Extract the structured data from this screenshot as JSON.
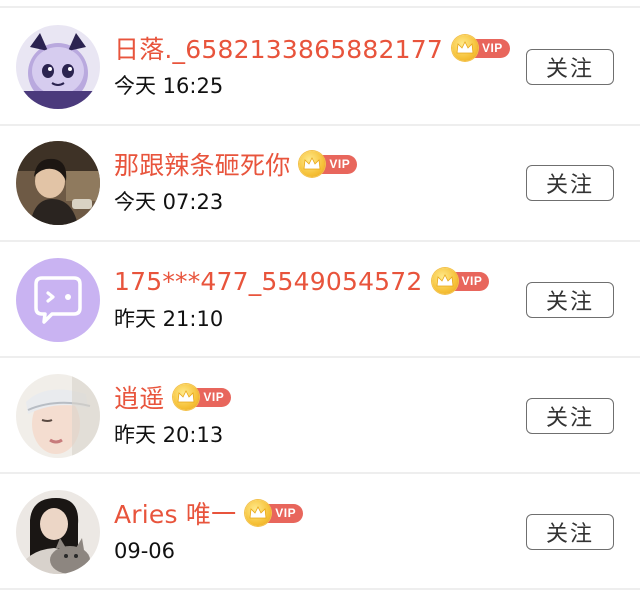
{
  "followers": [
    {
      "name": "日落._6582133865882177",
      "vip": "VIP",
      "time": "今天 16:25",
      "button": "关注",
      "avatar_icon": "cat-cartoon-avatar"
    },
    {
      "name": "那跟辣条砸死你",
      "vip": "VIP",
      "time": "今天 07:23",
      "button": "关注",
      "avatar_icon": "person-photo-avatar"
    },
    {
      "name": "175***477_5549054572",
      "vip": "VIP",
      "time": "昨天 21:10",
      "button": "关注",
      "avatar_icon": "chat-bubble-default-avatar"
    },
    {
      "name": "逍遥",
      "vip": "VIP",
      "time": "昨天 20:13",
      "button": "关注",
      "avatar_icon": "person-photo-avatar"
    },
    {
      "name": "Aries 唯一",
      "vip": "VIP",
      "time": "09-06",
      "button": "关注",
      "avatar_icon": "person-with-cat-avatar"
    }
  ],
  "colors": {
    "name": "#e8543c",
    "vip_badge": "#e8665c",
    "vip_crown": "#f6c23a",
    "default_avatar_bg": "#c9b3f2"
  }
}
